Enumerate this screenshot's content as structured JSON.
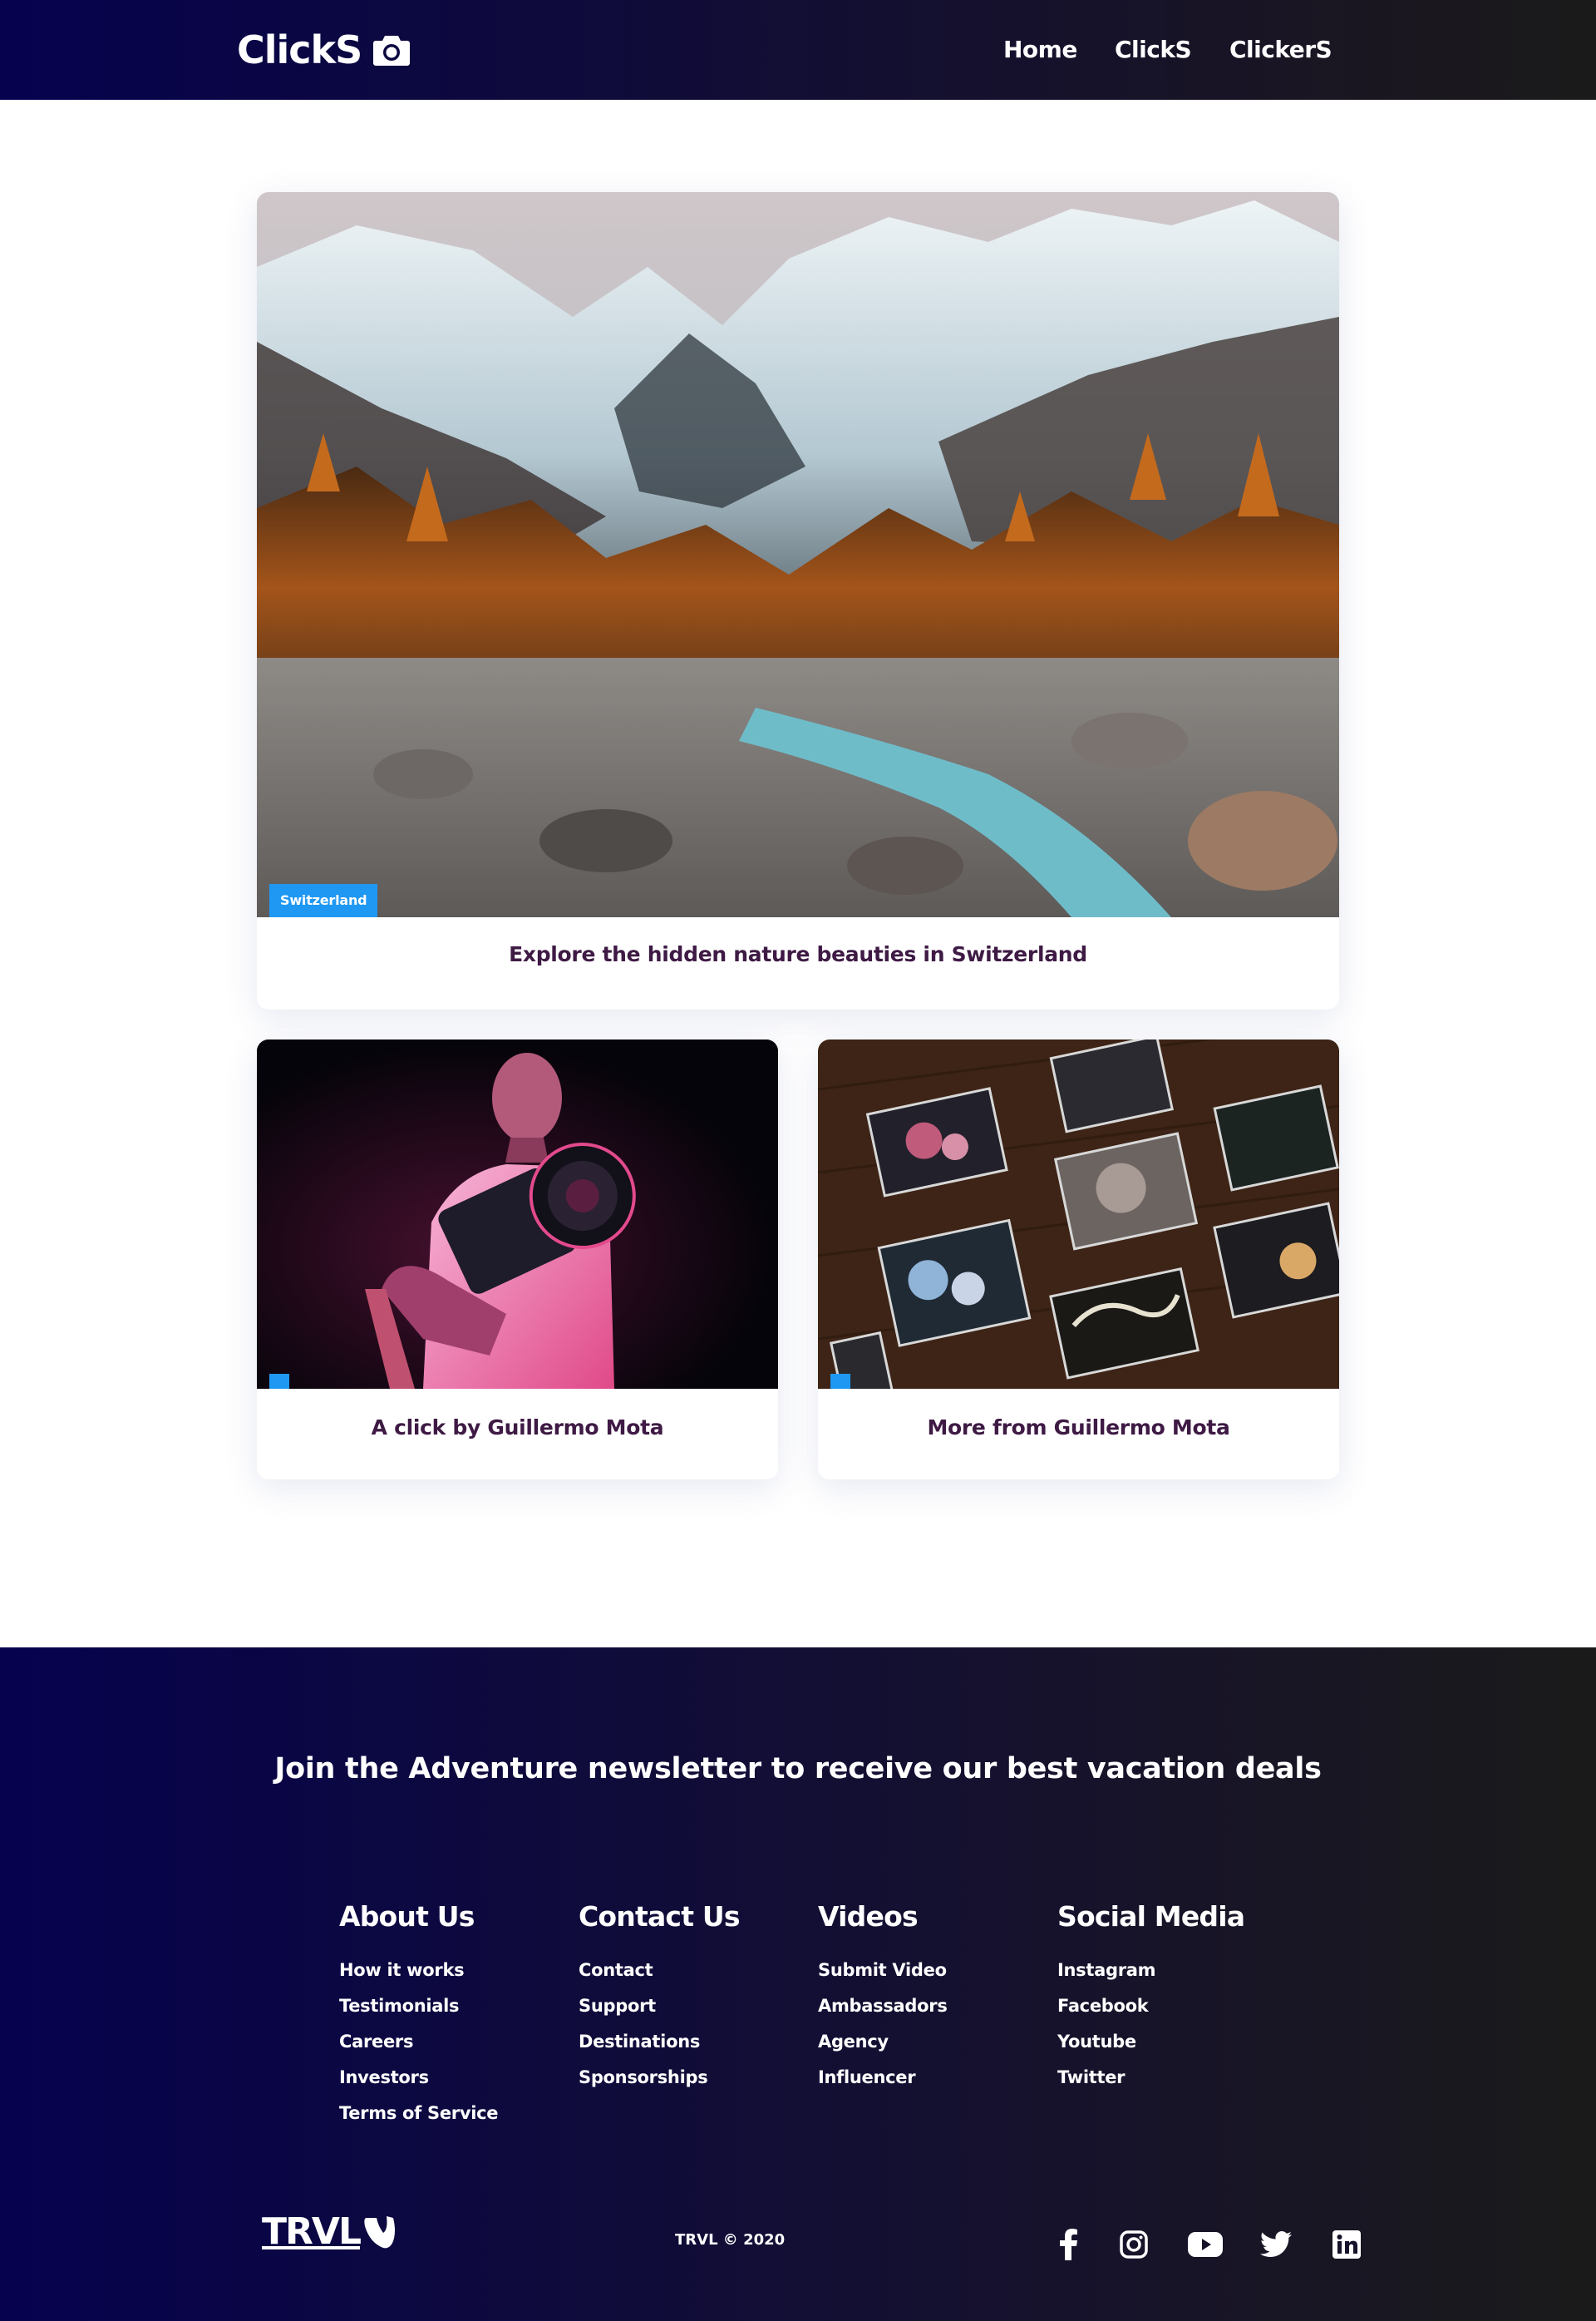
{
  "navbar": {
    "logo_text": "ClickS",
    "logo_icon": "camera-icon",
    "links": [
      "Home",
      "ClickS",
      "ClickerS"
    ]
  },
  "cards": [
    {
      "tag": "Switzerland",
      "caption": "Explore the hidden nature beauties in Switzerland"
    },
    {
      "tag": "",
      "caption": "A click by Guillermo Mota"
    },
    {
      "tag": "",
      "caption": "More from Guillermo Mota"
    }
  ],
  "footer": {
    "newsletter": "Join the Adventure newsletter to receive our best vacation deals",
    "columns": [
      {
        "title": "About Us",
        "links": [
          "How it works",
          "Testimonials",
          "Careers",
          "Investors",
          "Terms of Service"
        ]
      },
      {
        "title": "Contact Us",
        "links": [
          "Contact",
          "Support",
          "Destinations",
          "Sponsorships"
        ]
      },
      {
        "title": "Videos",
        "links": [
          "Submit Video",
          "Ambassadors",
          "Agency",
          "Influencer"
        ]
      },
      {
        "title": "Social Media",
        "links": [
          "Instagram",
          "Facebook",
          "Youtube",
          "Twitter"
        ]
      }
    ],
    "logo_text": "TRVL",
    "copyright": "TRVL © 2020",
    "social_icons": [
      "facebook-icon",
      "instagram-icon",
      "youtube-icon",
      "twitter-icon",
      "linkedin-icon"
    ]
  },
  "colors": {
    "nav_gradient_start": "#06024e",
    "nav_gradient_end": "#1a1a1a",
    "tag_blue": "#1f98f4",
    "caption_color": "#3e1a44"
  }
}
